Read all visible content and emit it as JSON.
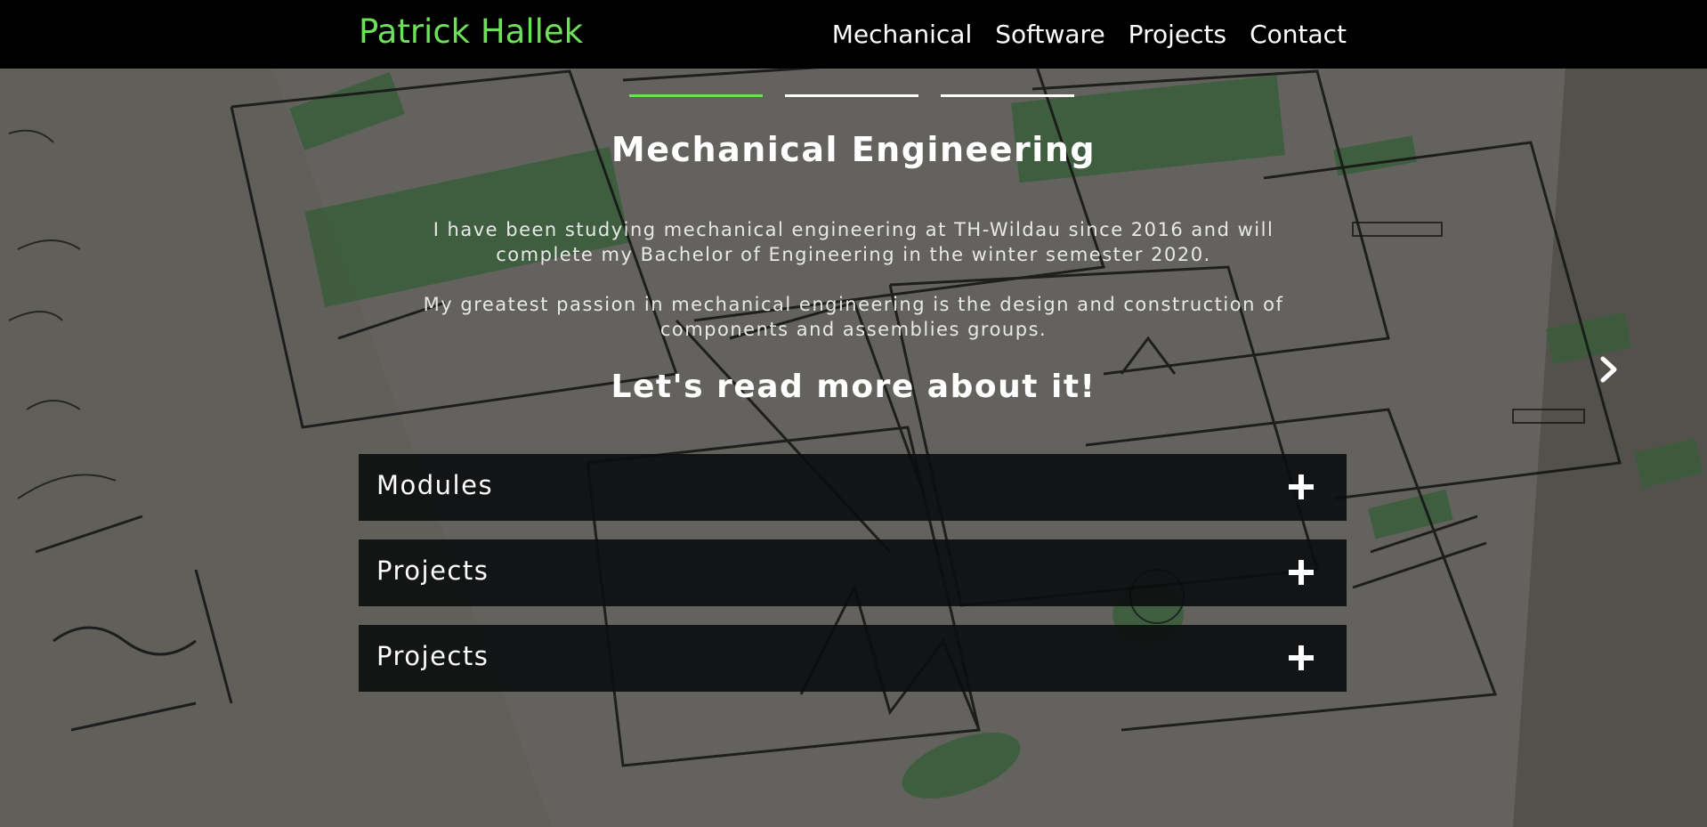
{
  "navbar": {
    "brand": "Patrick Hallek",
    "links": [
      "Mechanical",
      "Software",
      "Projects",
      "Contact"
    ]
  },
  "carousel": {
    "slide_count": 3,
    "active_slide": 0,
    "title": "Mechanical Engineering",
    "paragraphs": [
      "I have been studying mechanical engineering at TH-Wildau since 2016 and will complete my Bachelor of Engineering in the winter semester 2020.",
      "My greatest passion in mechanical engineering is the design and construction of components and assemblies groups."
    ],
    "cta": "Let's read more about it!",
    "next_icon": "chevron-right-icon"
  },
  "accordion": {
    "items": [
      {
        "label": "Modules",
        "icon": "plus-icon"
      },
      {
        "label": "Projects",
        "icon": "plus-icon"
      },
      {
        "label": "Projects",
        "icon": "plus-icon"
      }
    ]
  },
  "colors": {
    "accent": "#6ee05a",
    "navbar_bg": "#000000",
    "accordion_bg": "#0c0d0e",
    "text": "#ffffff"
  }
}
